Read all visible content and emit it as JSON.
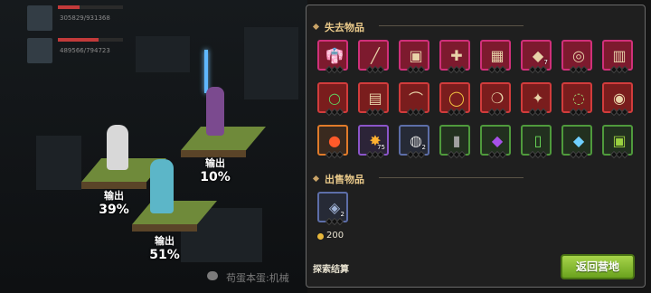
{
  "scene": {
    "party": [
      {
        "hp": "305829/931368",
        "hp_fraction": 0.33
      },
      {
        "hp": "489566/794723",
        "hp_fraction": 0.62
      }
    ],
    "heroes": [
      {
        "damage_label": "输出",
        "damage_pct": "10%"
      },
      {
        "damage_label": "输出",
        "damage_pct": "39%"
      },
      {
        "damage_label": "输出",
        "damage_pct": "51%"
      }
    ],
    "chat_text": "苟蛋本蛋:机械"
  },
  "panel": {
    "lost_title": "失去物品",
    "lost_items": [
      {
        "icon": "robe-icon",
        "rarity": "red"
      },
      {
        "icon": "staff-icon",
        "rarity": "red"
      },
      {
        "icon": "armor-icon",
        "rarity": "red"
      },
      {
        "icon": "scepter-icon",
        "rarity": "red"
      },
      {
        "icon": "plate-armor-icon",
        "rarity": "red"
      },
      {
        "icon": "shard-icon",
        "rarity": "red",
        "count": "7"
      },
      {
        "icon": "necklace-icon",
        "rarity": "red"
      },
      {
        "icon": "vest-icon",
        "rarity": "red"
      },
      {
        "icon": "ring-icon",
        "rarity": "red2"
      },
      {
        "icon": "coat-icon",
        "rarity": "red2"
      },
      {
        "icon": "bow-icon",
        "rarity": "red2"
      },
      {
        "icon": "gold-ring-icon",
        "rarity": "red2"
      },
      {
        "icon": "ruby-necklace-icon",
        "rarity": "red2"
      },
      {
        "icon": "wand-icon",
        "rarity": "red2"
      },
      {
        "icon": "jade-ring-icon",
        "rarity": "red2"
      },
      {
        "icon": "pendant-icon",
        "rarity": "red2"
      },
      {
        "icon": "fire-orb-icon",
        "rarity": "orange"
      },
      {
        "icon": "spark-orb-icon",
        "rarity": "purple",
        "count": "75"
      },
      {
        "icon": "silver-orb-icon",
        "rarity": "blue",
        "count": "2"
      },
      {
        "icon": "scroll-icon",
        "rarity": "green"
      },
      {
        "icon": "amethyst-icon",
        "rarity": "green"
      },
      {
        "icon": "potion-icon",
        "rarity": "green"
      },
      {
        "icon": "crystal-icon",
        "rarity": "green"
      },
      {
        "icon": "jar-icon",
        "rarity": "green"
      }
    ],
    "sold_title": "出售物品",
    "sold_items": [
      {
        "icon": "rune-stone-icon",
        "rarity": "blue",
        "count": "2"
      }
    ],
    "gold_value": "200",
    "settle_label": "探索结算",
    "return_label": "返回营地"
  },
  "colors": {
    "title": "#e9c98a",
    "button": "#8cc039",
    "panel_bg": "#1f1f1f"
  }
}
